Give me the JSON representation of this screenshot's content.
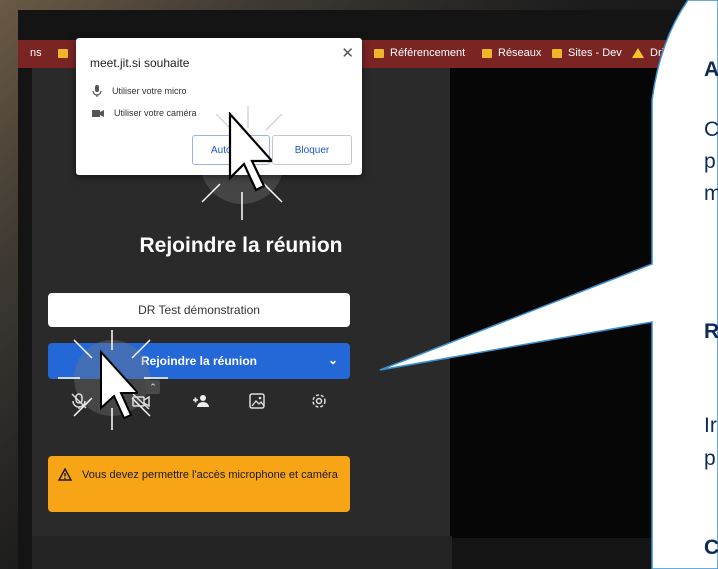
{
  "browser": {
    "bookmarks_left_cut": "ns",
    "bookmarks": [
      {
        "label": "Référencement"
      },
      {
        "label": "Réseaux"
      },
      {
        "label": "Sites - Dev"
      },
      {
        "label": "Driv"
      }
    ]
  },
  "permission_popup": {
    "title": "meet.jit.si souhaite",
    "mic_label": "Utiliser votre micro",
    "camera_label": "Utiliser votre caméra",
    "allow_label": "Autoriser",
    "block_label": "Bloquer"
  },
  "prejoin": {
    "heading": "Rejoindre la réunion",
    "name_value": "DR Test démonstration",
    "join_label": "Rejoindre la réunion",
    "warning_text": "Vous devez permettre l'accès microphone et caméra"
  },
  "callout": {
    "heading1": "A",
    "body1_line1": "C",
    "body1_line2": "p",
    "body1_line3": "m",
    "heading2": "R",
    "body2_line1": "Ir",
    "body2_line2": "p",
    "heading3": "C"
  },
  "colors": {
    "accent": "#2467d6",
    "warning": "#f7a417",
    "bookmark_bar": "#7a2424",
    "callout_text": "#0e2a55"
  }
}
